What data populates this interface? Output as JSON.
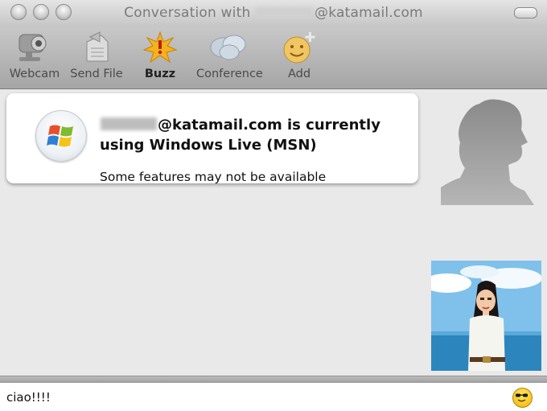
{
  "window": {
    "title_prefix": "Conversation with",
    "title_suffix": "@katamail.com"
  },
  "toolbar": {
    "items": [
      {
        "label": "Webcam",
        "icon": "webcam-icon"
      },
      {
        "label": "Send File",
        "icon": "send-file-icon"
      },
      {
        "label": "Buzz",
        "icon": "buzz-icon"
      },
      {
        "label": "Conference",
        "icon": "conference-icon"
      },
      {
        "label": "Add",
        "icon": "add-contact-icon"
      }
    ]
  },
  "notice": {
    "line1_suffix": "@katamail.com is currently",
    "line2": "using Windows Live (MSN)",
    "note": "Some features may not be available",
    "icon": "windows-logo-icon"
  },
  "composer": {
    "value": "ciao!!!!",
    "emoticon_icon": "sunglasses-emoticon-icon"
  },
  "colors": {
    "toolbar_top": "#c8c8c8",
    "toolbar_bottom": "#a5a5a5",
    "chat_background": "#e9e9e9",
    "buzz_star": "#f6b21b"
  }
}
